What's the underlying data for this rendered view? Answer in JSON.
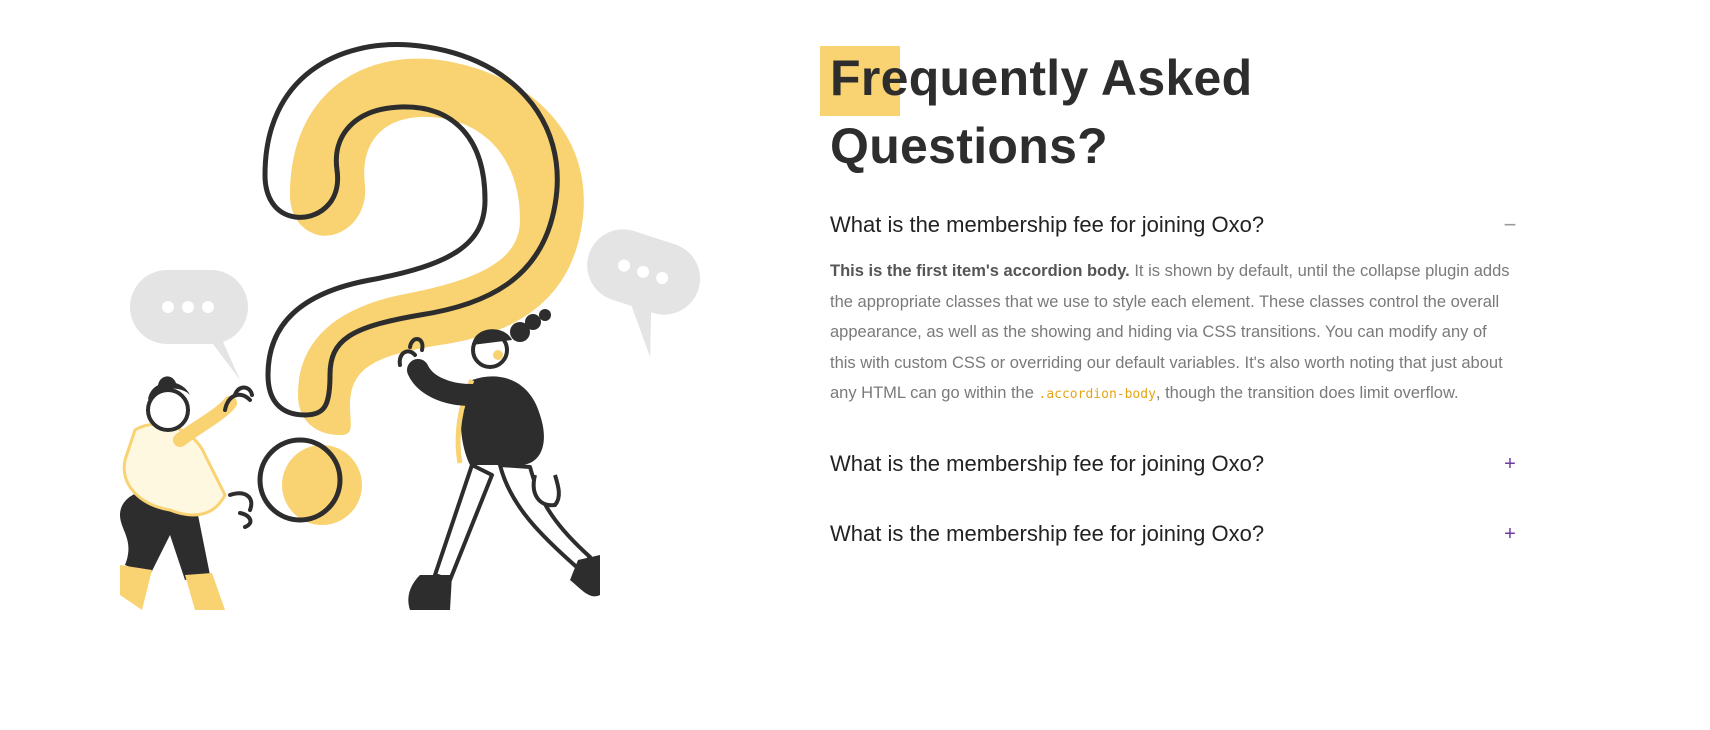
{
  "faq": {
    "title": "Frequently Asked Questions?",
    "items": [
      {
        "question": "What is the membership fee for joining Oxo?",
        "toggle": "−",
        "expanded": true,
        "body_strong": "This is the first item's accordion body.",
        "body_text_1": " It is shown by default, until the collapse plugin adds the appropriate classes that we use to style each element. These classes control the overall appearance, as well as the showing and hiding via CSS transitions. You can modify any of this with custom CSS or overriding our default variables. It's also worth noting that just about any HTML can go within the ",
        "body_code": ".accordion-body",
        "body_text_2": ", though the transition does limit overflow."
      },
      {
        "question": "What is the membership fee for joining Oxo?",
        "toggle": "+",
        "expanded": false
      },
      {
        "question": "What is the membership fee for joining Oxo?",
        "toggle": "+",
        "expanded": false
      }
    ]
  },
  "colors": {
    "accent_yellow": "#f9d271",
    "ink": "#2d2d2d",
    "bubble_gray": "#e4e4e4",
    "toggle_purple": "#6c3aa0"
  },
  "illustration": {
    "icons": [
      "question-mark-illustration",
      "chat-bubble-icon",
      "person-illustration"
    ]
  }
}
